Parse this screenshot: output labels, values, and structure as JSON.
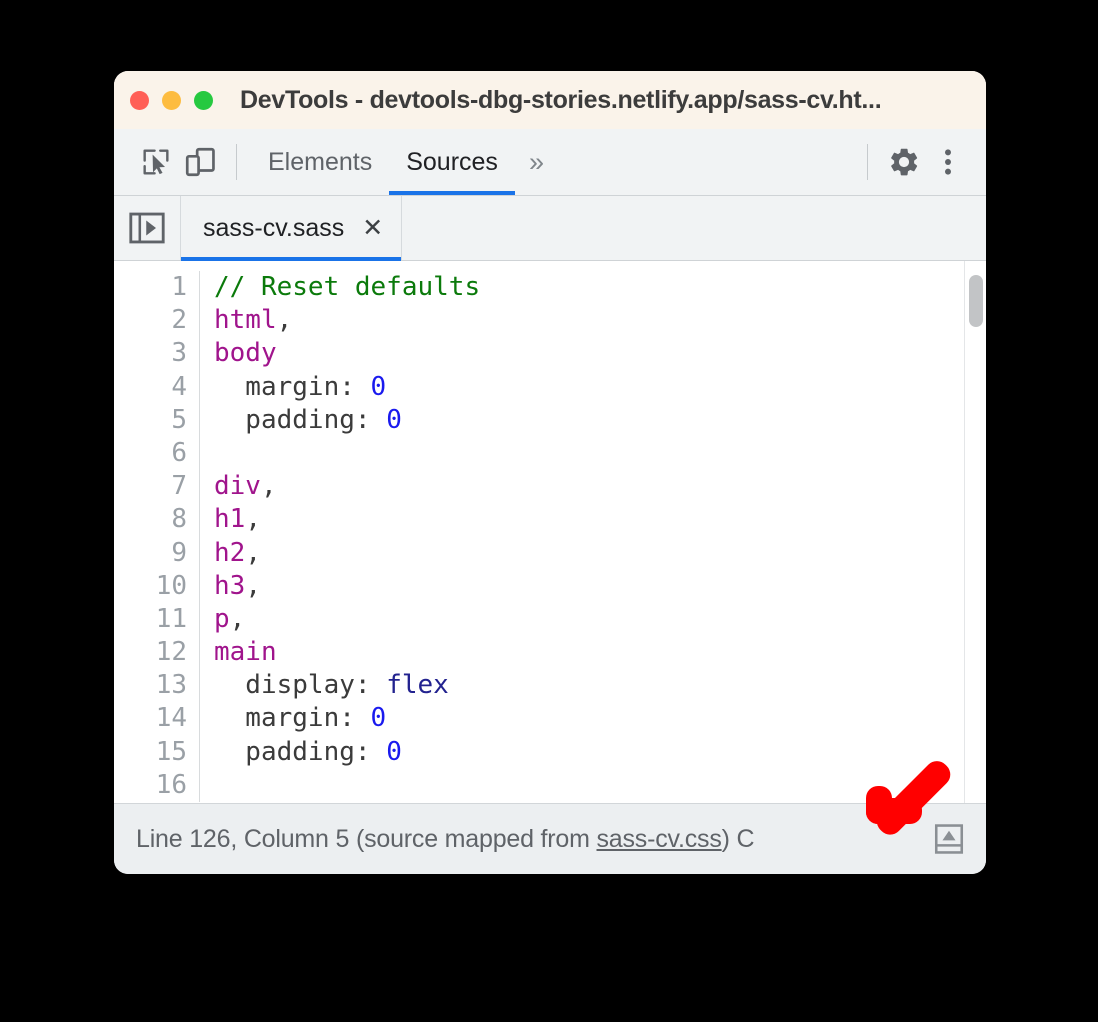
{
  "window": {
    "title": "DevTools - devtools-dbg-stories.netlify.app/sass-cv.ht...",
    "traffic_lights": [
      {
        "name": "close",
        "color": "#ff5f56"
      },
      {
        "name": "minimize",
        "color": "#fdbc40"
      },
      {
        "name": "zoom",
        "color": "#26c940"
      }
    ]
  },
  "toolbar": {
    "inspect_icon": "inspect-element-icon",
    "device_icon": "device-toolbar-icon",
    "panels": [
      {
        "label": "Elements",
        "active": false
      },
      {
        "label": "Sources",
        "active": true
      }
    ],
    "overflow_label": "»",
    "settings_icon": "gear-icon",
    "more_icon": "more-vertical-icon"
  },
  "tabstrip": {
    "navigator_toggle_icon": "show-navigator-icon",
    "tabs": [
      {
        "label": "sass-cv.sass",
        "close_label": "✕",
        "active": true
      }
    ]
  },
  "editor": {
    "line_numbers": [
      "1",
      "2",
      "3",
      "4",
      "5",
      "6",
      "7",
      "8",
      "9",
      "10",
      "11",
      "12",
      "13",
      "14",
      "15",
      "16"
    ],
    "lines": [
      [
        {
          "text": "// Reset defaults",
          "type": "comment"
        }
      ],
      [
        {
          "text": "html",
          "type": "selector"
        },
        {
          "text": ",",
          "type": "punct"
        }
      ],
      [
        {
          "text": "body",
          "type": "selector"
        }
      ],
      [
        {
          "text": "  margin: ",
          "type": "prop"
        },
        {
          "text": "0",
          "type": "number"
        }
      ],
      [
        {
          "text": "  padding: ",
          "type": "prop"
        },
        {
          "text": "0",
          "type": "number"
        }
      ],
      [
        {
          "text": "",
          "type": "prop"
        }
      ],
      [
        {
          "text": "div",
          "type": "selector"
        },
        {
          "text": ",",
          "type": "punct"
        }
      ],
      [
        {
          "text": "h1",
          "type": "selector"
        },
        {
          "text": ",",
          "type": "punct"
        }
      ],
      [
        {
          "text": "h2",
          "type": "selector"
        },
        {
          "text": ",",
          "type": "punct"
        }
      ],
      [
        {
          "text": "h3",
          "type": "selector"
        },
        {
          "text": ",",
          "type": "punct"
        }
      ],
      [
        {
          "text": "p",
          "type": "selector"
        },
        {
          "text": ",",
          "type": "punct"
        }
      ],
      [
        {
          "text": "main",
          "type": "selector"
        }
      ],
      [
        {
          "text": "  display: ",
          "type": "prop"
        },
        {
          "text": "flex",
          "type": "value"
        }
      ],
      [
        {
          "text": "  margin: ",
          "type": "prop"
        },
        {
          "text": "0",
          "type": "number"
        }
      ],
      [
        {
          "text": "  padding: ",
          "type": "prop"
        },
        {
          "text": "0",
          "type": "number"
        }
      ],
      [
        {
          "text": "",
          "type": "prop"
        }
      ]
    ],
    "scrollbar": {
      "name": "editor-vertical-scrollbar"
    }
  },
  "statusbar": {
    "prefix": "Line 126, Column 5  (source mapped from ",
    "map_link": "sass-cv.css",
    "suffix": ") C",
    "format_button_icon": "pretty-print-icon"
  },
  "annotation": {
    "arrow_icon": "red-arrow-down-left",
    "color": "#ff0000"
  },
  "colors": {
    "accent": "#1a73e8",
    "titlebar_bg": "#faf3ea",
    "toolbar_bg": "#f1f3f4",
    "statusbar_bg": "#eceff1",
    "comment": "#0b7a0b",
    "selector": "#a0148c",
    "number": "#1a1aee",
    "value": "#22228f"
  }
}
